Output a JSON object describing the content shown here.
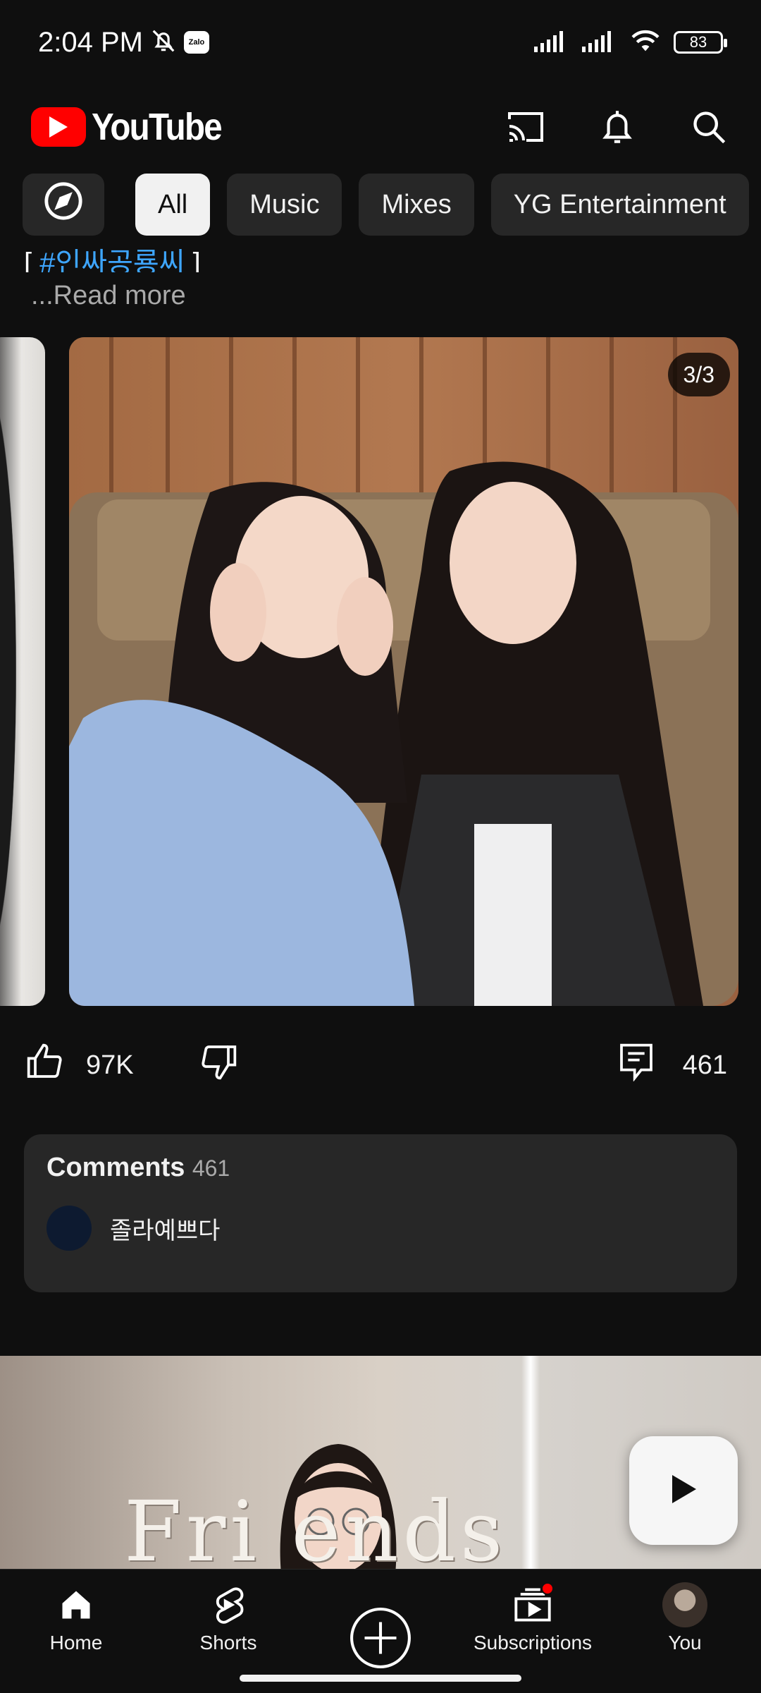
{
  "status_bar": {
    "time": "2:04 PM",
    "zalo_label": "Zalo",
    "battery": "83"
  },
  "header": {
    "logo_text": "YouTube",
    "icons": [
      "cast-icon",
      "bell-icon",
      "search-icon"
    ]
  },
  "chips": [
    {
      "label": "All",
      "active": true
    },
    {
      "label": "Music",
      "active": false
    },
    {
      "label": "Mixes",
      "active": false
    },
    {
      "label": "YG Entertainment",
      "active": false
    }
  ],
  "post": {
    "hashtag_prefix": "[ ",
    "hashtag": "#인싸공룡씨",
    "hashtag_suffix": " ]",
    "read_more": "...Read more",
    "image_counter": "3/3",
    "likes": "97K",
    "comment_count": "461"
  },
  "comments": {
    "title": "Comments",
    "count": "461",
    "top_comment": "졸라예쁘다"
  },
  "next_video": {
    "overlay_text": "Fri    ends"
  },
  "bottom_nav": {
    "home": "Home",
    "shorts": "Shorts",
    "subscriptions": "Subscriptions",
    "you": "You"
  },
  "colors": {
    "background": "#0f0f0f",
    "brand_red": "#ff0000",
    "chip_bg": "#272727",
    "link_blue": "#3ea6ff"
  }
}
